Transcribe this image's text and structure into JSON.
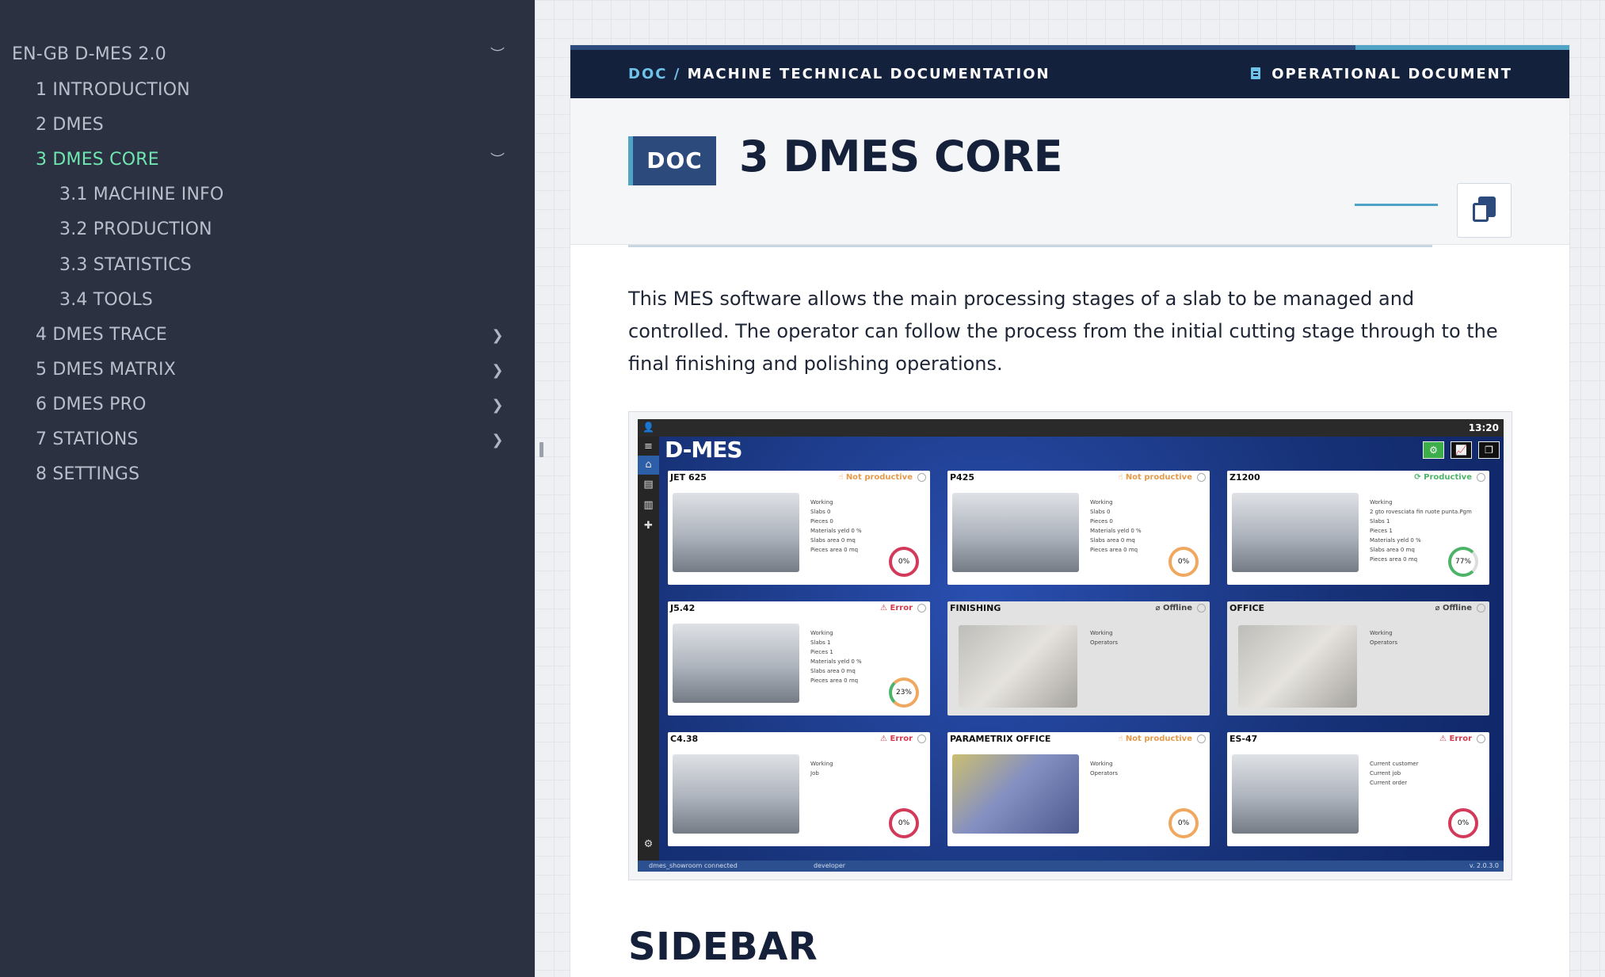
{
  "sidebar": {
    "root": "EN-GB D-MES 2.0",
    "items": [
      {
        "label": "1 INTRODUCTION"
      },
      {
        "label": "2 DMES"
      },
      {
        "label": "3 DMES CORE",
        "active": true
      },
      {
        "label": "3.1 MACHINE INFO"
      },
      {
        "label": "3.2 PRODUCTION"
      },
      {
        "label": "3.3 STATISTICS"
      },
      {
        "label": "3.4 TOOLS"
      },
      {
        "label": "4 DMES TRACE"
      },
      {
        "label": "5 DMES MATRIX"
      },
      {
        "label": "6 DMES PRO"
      },
      {
        "label": "7 STATIONS"
      },
      {
        "label": "8 SETTINGS"
      }
    ]
  },
  "header": {
    "crumb_root": "DOC",
    "crumb_sep": "/",
    "crumb_page": "MACHINE TECHNICAL DOCUMENTATION",
    "doc_type": "OPERATIONAL DOCUMENT"
  },
  "title": {
    "badge": "DOC",
    "text": "3 DMES CORE"
  },
  "body": {
    "intro": "This MES software allows the main processing stages of a slab to be managed and controlled. The operator can follow the process from the initial cutting stage through to the final finishing and polishing operations.",
    "section_heading": "SIDEBAR"
  },
  "screenshot": {
    "time": "13:20",
    "logo": "D-MES",
    "footer_left": "dmes_showroom connected",
    "footer_user": "developer",
    "footer_version": "v. 2.0.3.0",
    "tiles": [
      {
        "name": "JET 625",
        "status": "Not productive",
        "gauge": "0%",
        "lines": [
          "Working",
          "Slabs 0",
          "Pieces 0",
          "Materials yeld 0 %"
        ],
        "extra": [
          "Slabs area 0 mq",
          "Pieces area 0 mq"
        ]
      },
      {
        "name": "P425",
        "status": "Not productive",
        "gauge": "0%",
        "lines": [
          "Working",
          "Slabs 0",
          "Pieces 0",
          "Materials yeld 0 %"
        ],
        "extra": [
          "Slabs area 0 mq",
          "Pieces area 0 mq"
        ]
      },
      {
        "name": "Z1200",
        "status": "Productive",
        "gauge": "77%",
        "lines": [
          "Working",
          "2 gto rovesciata fin ruote punta.Pgm",
          "Slabs 1",
          "Pieces 1",
          "Materials yeld 0 %"
        ],
        "extra": [
          "Slabs area 0 mq",
          "Pieces area 0 mq"
        ]
      },
      {
        "name": "J5.42",
        "status": "Error",
        "gauge": "23%",
        "lines": [
          "Working",
          "Slabs 1",
          "Pieces 1",
          "Materials yeld 0 %"
        ],
        "extra": [
          "Slabs area 0 mq",
          "Pieces area 0 mq"
        ]
      },
      {
        "name": "FINISHING",
        "status": "Offline",
        "gauge": "",
        "lines": [
          "Working",
          "Operators"
        ],
        "extra": []
      },
      {
        "name": "OFFICE",
        "status": "Offline",
        "gauge": "",
        "lines": [
          "Working",
          "Operators"
        ],
        "extra": []
      },
      {
        "name": "C4.38",
        "status": "Error",
        "gauge": "0%",
        "lines": [
          "Working",
          "Job"
        ],
        "extra": []
      },
      {
        "name": "PARAMETRIX OFFICE",
        "status": "Not productive",
        "gauge": "0%",
        "lines": [
          "Working",
          "Operators"
        ],
        "extra": []
      },
      {
        "name": "ES-47",
        "status": "Error",
        "gauge": "0%",
        "lines": [
          "Current customer",
          "Current job",
          "Current order"
        ],
        "extra": []
      }
    ]
  },
  "colors": {
    "sidebar_bg": "#2c3142",
    "active_nav": "#6ee7b0",
    "header_bg": "#14213d",
    "accent": "#4fa3c7",
    "badge_bg": "#2c4a7c"
  }
}
